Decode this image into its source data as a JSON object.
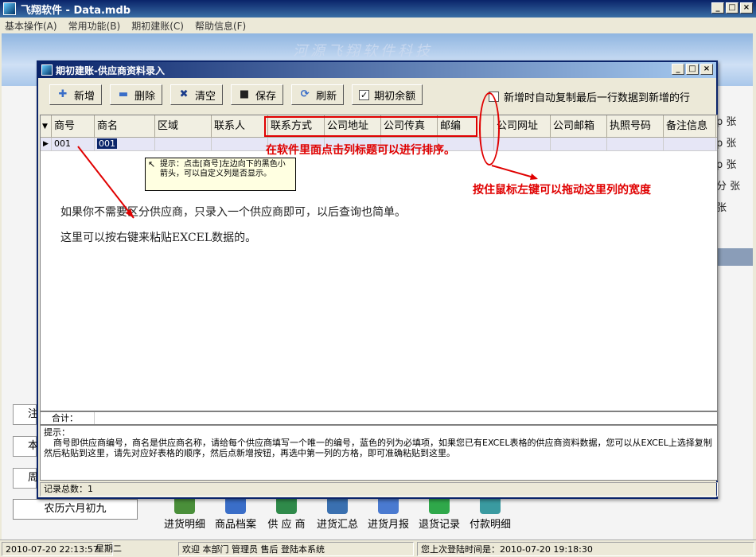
{
  "main_window": {
    "title": "飞翔软件 - Data.mdb",
    "menu": [
      "基本操作(A)",
      "常用功能(B)",
      "期初建账(C)",
      "帮助信息(F)"
    ],
    "banner_text": "河源飞翔软件科技",
    "right_side_items": [
      "p 张",
      "p 张",
      "p 张",
      "分 张",
      "张"
    ],
    "left_boxes": [
      "注",
      "本",
      "周"
    ],
    "lunar_date": "农历六月初九",
    "bottom_shortcuts": [
      {
        "label": "进货明细",
        "icon": "list-icon",
        "color": "#4a8f3a"
      },
      {
        "label": "商品档案",
        "icon": "network-icon",
        "color": "#3a6ec8"
      },
      {
        "label": "供 应 商",
        "icon": "people-icon",
        "color": "#2f8a4a"
      },
      {
        "label": "进货汇总",
        "icon": "summary-icon",
        "color": "#3a70b0"
      },
      {
        "label": "进货月报",
        "icon": "report-icon",
        "color": "#4a7ad0"
      },
      {
        "label": "退货记录",
        "icon": "return-icon",
        "color": "#2fa84a"
      },
      {
        "label": "付款明细",
        "icon": "payment-icon",
        "color": "#3a9aa0"
      }
    ],
    "status": {
      "datetime": "2010-07-20 22:13:57",
      "weekday": "星期二",
      "welcome": "欢迎 本部门 管理员 售后 登陆本系统",
      "last_login": "您上次登陆时间是：2010-07-20 19:18:30"
    }
  },
  "dialog": {
    "title": "期初建账-供应商资料录入",
    "toolbar": [
      {
        "label": "新增",
        "icon": "plus-icon",
        "glyph": "✚",
        "color": "#3a6ec8"
      },
      {
        "label": "删除",
        "icon": "minus-icon",
        "glyph": "▬",
        "color": "#3a6ec8"
      },
      {
        "label": "清空",
        "icon": "clear-icon",
        "glyph": "✖",
        "color": "#1a3c8a"
      },
      {
        "label": "保存",
        "icon": "save-icon",
        "glyph": "■",
        "color": "#222222"
      },
      {
        "label": "刷新",
        "icon": "refresh-icon",
        "glyph": "⟳",
        "color": "#3a6ec8"
      },
      {
        "label": "期初余额",
        "icon": "checkbox-icon",
        "glyph": "✓",
        "color": "#000000"
      }
    ],
    "auto_copy_label": "新增时自动复制最后一行数据到新增的行",
    "columns": [
      "商号",
      "商名",
      "区域",
      "联系人",
      "联系方式",
      "公司地址",
      "公司传真",
      "邮编",
      "公司网址",
      "公司邮箱",
      "执照号码",
      "备注信息"
    ],
    "rows": [
      [
        "001",
        "001",
        "",
        "",
        "",
        "",
        "",
        "",
        "",
        "",
        "",
        ""
      ]
    ],
    "tooltip": "提示：点击[商号]左边向下的黑色小箭头，可以自定义列是否显示。",
    "help_lines": [
      "如果你不需要区分供应商，只录入一个供应商即可，以后查询也简单。",
      "这里可以按右键来粘贴EXCEL数据的。"
    ],
    "annotations": {
      "sort_hint": "在软件里面点击列标题可以进行排序。",
      "drag_hint": "按住鼠标左键可以拖动这里列的宽度"
    },
    "sum_label": "合计：",
    "hint_title": "提示：",
    "hint_body": "商号即供应商编号，商名是供应商名称，请给每个供应商填写一个唯一的编号，蓝色的列为必填项，如果您已有EXCEL表格的供应商资料数据，您可以从EXCEL上选择复制然后粘贴到这里，请先对应好表格的顺序，然后点新增按钮，再选中第一列的方格，即可准确粘贴到这里。",
    "record_count": "记录总数：1"
  },
  "colors": {
    "titlebar": "#0a246a",
    "annotation": "#e00000",
    "row_highlight": "#e6e6f6"
  }
}
